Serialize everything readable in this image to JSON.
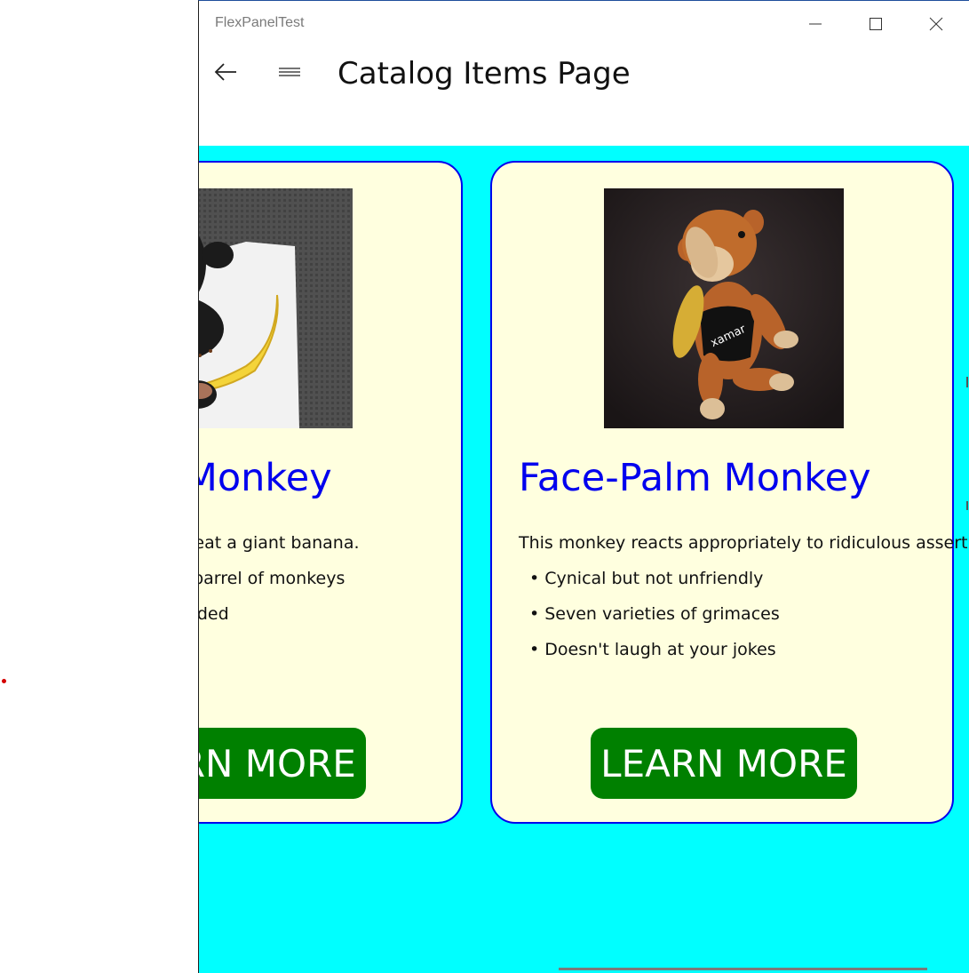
{
  "window": {
    "title": "FlexPanelTest"
  },
  "header": {
    "title": "Catalog Items Page"
  },
  "cards": [
    {
      "title": "Banana Monkey",
      "description": "Watch this monkey eat a giant banana.",
      "bullets": [
        "More fun than a barrel of monkeys",
        "Monkey not included"
      ],
      "button_label": "LEARN MORE"
    },
    {
      "title": "Face-Palm Monkey",
      "description": "This monkey reacts appropriately to ridiculous assertions and actions.",
      "bullets": [
        "Cynical but not unfriendly",
        "Seven varieties of grimaces",
        "Doesn't laugh at your jokes"
      ],
      "button_label": "LEARN MORE"
    }
  ],
  "colors": {
    "content_background": "#00ffff",
    "card_background": "#ffffdf",
    "card_border": "#0000ee",
    "title_color": "#0000ee",
    "button_background": "#008000",
    "button_text": "#ffffff"
  }
}
